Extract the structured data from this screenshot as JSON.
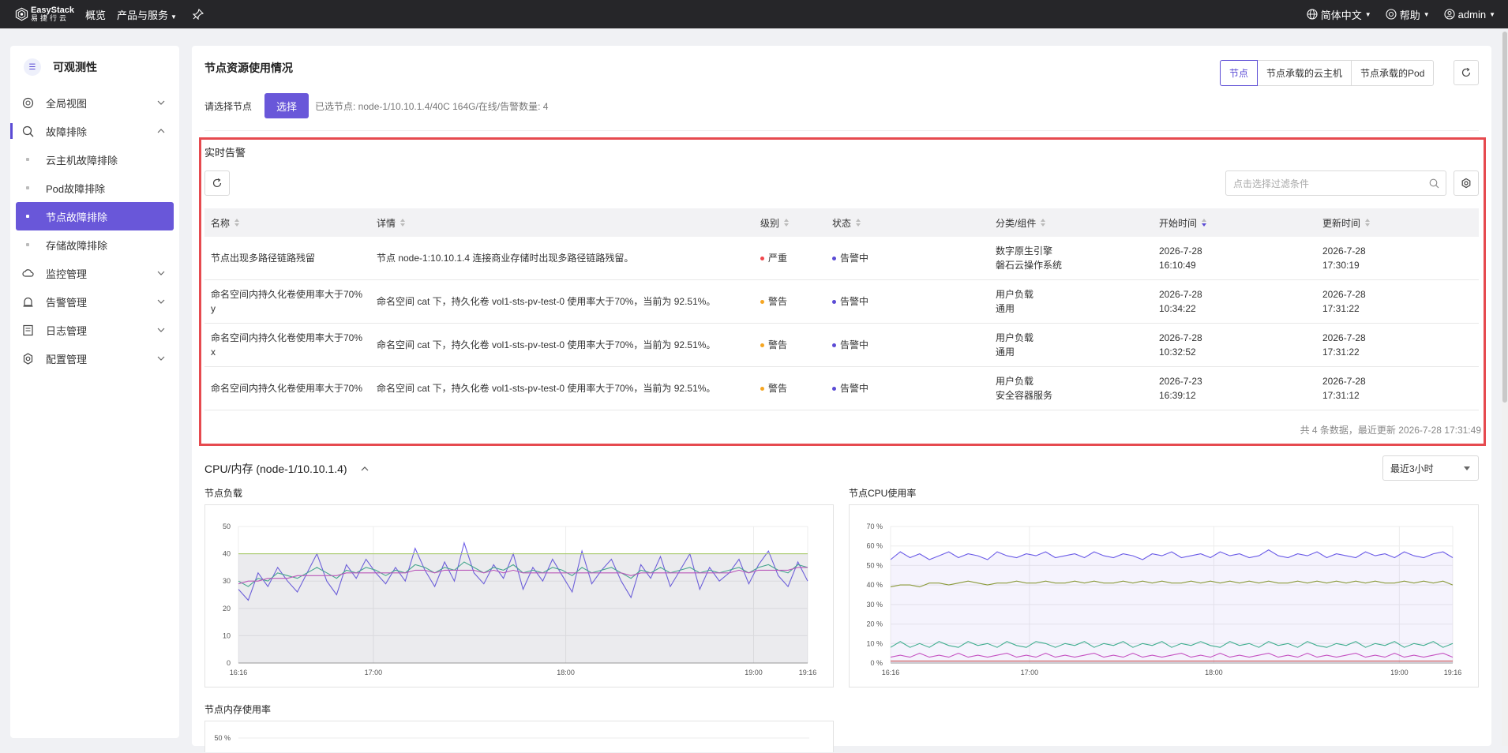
{
  "topbar": {
    "logo_line1": "EasyStack",
    "logo_line2": "易捷行云",
    "nav": [
      {
        "label": "概览"
      },
      {
        "label": "产品与服务"
      }
    ],
    "right": {
      "language": "简体中文",
      "help": "帮助",
      "user": "admin"
    }
  },
  "sidebar": {
    "title": "可观测性",
    "items": [
      {
        "label": "全局视图",
        "icon": "globe-icon"
      },
      {
        "label": "故障排除",
        "icon": "search-icon",
        "open": true,
        "children": [
          {
            "label": "云主机故障排除"
          },
          {
            "label": "Pod故障排除"
          },
          {
            "label": "节点故障排除",
            "active": true
          },
          {
            "label": "存储故障排除"
          }
        ]
      },
      {
        "label": "监控管理",
        "icon": "cloud-icon"
      },
      {
        "label": "告警管理",
        "icon": "alarm-icon"
      },
      {
        "label": "日志管理",
        "icon": "log-icon"
      },
      {
        "label": "配置管理",
        "icon": "gear-icon"
      }
    ]
  },
  "main": {
    "title": "节点资源使用情况",
    "tabs": [
      "节点",
      "节点承载的云主机",
      "节点承载的Pod"
    ],
    "select_label": "请选择节点",
    "select_button": "选择",
    "selected_info": "已选节点:  node-1/10.10.1.4/40C 164G/在线/告警数量: 4"
  },
  "alerts": {
    "title": "实时告警",
    "search_placeholder": "点击选择过滤条件",
    "columns": [
      "名称",
      "详情",
      "级别",
      "状态",
      "分类/组件",
      "开始时间",
      "更新时间"
    ],
    "rows": [
      {
        "name": "节点出现多路径链路残留",
        "detail": "节点 node-1:10.10.1.4 连接商业存储时出现多路径链路残留。",
        "level": "严重",
        "level_color": "#f0474d",
        "status": "告警中",
        "cat1": "数字原生引擎",
        "cat2": "磐石云操作系统",
        "start1": "2026-7-28",
        "start2": "16:10:49",
        "upd1": "2026-7-28",
        "upd2": "17:30:19"
      },
      {
        "name": "命名空间内持久化卷使用率大于70%",
        "name2": "y",
        "detail": "命名空间 cat 下，持久化卷 vol1-sts-pv-test-0 使用率大于70%，当前为 92.51%。",
        "level": "警告",
        "level_color": "#f5a623",
        "status": "告警中",
        "cat1": "用户负载",
        "cat2": "通用",
        "start1": "2026-7-28",
        "start2": "10:34:22",
        "upd1": "2026-7-28",
        "upd2": "17:31:22"
      },
      {
        "name": "命名空间内持久化卷使用率大于70%",
        "name2": "x",
        "detail": "命名空间 cat 下，持久化卷 vol1-sts-pv-test-0 使用率大于70%，当前为 92.51%。",
        "level": "警告",
        "level_color": "#f5a623",
        "status": "告警中",
        "cat1": "用户负载",
        "cat2": "通用",
        "start1": "2026-7-28",
        "start2": "10:32:52",
        "upd1": "2026-7-28",
        "upd2": "17:31:22"
      },
      {
        "name": "命名空间内持久化卷使用率大于70%",
        "name2": "",
        "detail": "命名空间 cat 下，持久化卷 vol1-sts-pv-test-0 使用率大于70%，当前为 92.51%。",
        "level": "警告",
        "level_color": "#f5a623",
        "status": "告警中",
        "cat1": "用户负载",
        "cat2": "安全容器服务",
        "start1": "2026-7-23",
        "start2": "16:39:12",
        "upd1": "2026-7-28",
        "upd2": "17:31:12"
      }
    ],
    "footer": "共 4 条数据，最近更新  2026-7-28 17:31:49"
  },
  "cpu": {
    "title": "CPU/内存 (node-1/10.10.1.4)",
    "range": "最近3小时"
  },
  "chart_data": [
    {
      "type": "line",
      "title": "节点负载",
      "x_ticks": [
        "16:16",
        "17:00",
        "18:00",
        "19:00",
        "19:16"
      ],
      "y_ticks": [
        "0",
        "10",
        "20",
        "30",
        "40",
        "50"
      ],
      "ylim": [
        0,
        50
      ],
      "series": [
        {
          "values": [
            27,
            23,
            33,
            28,
            35,
            30,
            26,
            33,
            40,
            30,
            25,
            36,
            31,
            38,
            33,
            29,
            35,
            30,
            42,
            34,
            28,
            37,
            30,
            44,
            33,
            29,
            36,
            31,
            40,
            27,
            35,
            30,
            38,
            32,
            26,
            41,
            29,
            34,
            38,
            30,
            24,
            36,
            31,
            39,
            28,
            34,
            40,
            27,
            35,
            30,
            33,
            38,
            29,
            36,
            41,
            32,
            28,
            37,
            30
          ]
        },
        {
          "values": [
            30,
            28,
            31,
            30,
            33,
            32,
            31,
            33,
            35,
            33,
            31,
            34,
            33,
            35,
            34,
            32,
            34,
            33,
            36,
            35,
            33,
            35,
            34,
            37,
            35,
            33,
            35,
            34,
            36,
            33,
            34,
            33,
            35,
            34,
            32,
            35,
            33,
            34,
            35,
            33,
            31,
            34,
            33,
            35,
            33,
            34,
            35,
            33,
            34,
            33,
            34,
            35,
            33,
            35,
            36,
            34,
            33,
            36,
            35
          ]
        },
        {
          "values": [
            29,
            30,
            30,
            31,
            31,
            31,
            32,
            32,
            32,
            32,
            32,
            33,
            33,
            33,
            33,
            33,
            33,
            33,
            34,
            34,
            33,
            34,
            34,
            34,
            34,
            33,
            34,
            33,
            34,
            33,
            33,
            33,
            33,
            33,
            33,
            33,
            33,
            33,
            33,
            33,
            32,
            33,
            33,
            33,
            33,
            33,
            33,
            33,
            33,
            33,
            33,
            34,
            33,
            34,
            34,
            34,
            34,
            35,
            35
          ]
        },
        {
          "values": [
            40,
            40,
            40,
            40,
            40,
            40,
            40,
            40,
            40,
            40,
            40,
            40,
            40,
            40,
            40,
            40,
            40,
            40,
            40,
            40,
            40,
            40,
            40,
            40,
            40,
            40,
            40,
            40,
            40,
            40,
            40,
            40,
            40,
            40,
            40,
            40,
            40,
            40,
            40,
            40,
            40,
            40,
            40,
            40,
            40,
            40,
            40,
            40,
            40,
            40,
            40,
            40,
            40,
            40,
            40,
            40,
            40,
            40,
            40
          ]
        }
      ]
    },
    {
      "type": "line",
      "title": "节点CPU使用率",
      "x_ticks": [
        "16:16",
        "17:00",
        "18:00",
        "19:00",
        "19:16"
      ],
      "y_ticks": [
        "0 %",
        "10 %",
        "20 %",
        "30 %",
        "40 %",
        "50 %",
        "60 %",
        "70 %"
      ],
      "ylim": [
        0,
        70
      ],
      "series": [
        {
          "values": [
            53,
            57,
            54,
            56,
            53,
            55,
            57,
            54,
            56,
            55,
            53,
            57,
            55,
            54,
            56,
            55,
            57,
            54,
            55,
            56,
            54,
            57,
            55,
            54,
            56,
            55,
            53,
            56,
            55,
            57,
            54,
            55,
            56,
            54,
            57,
            55,
            56,
            54,
            55,
            58,
            55,
            54,
            56,
            55,
            57,
            54,
            56,
            55,
            54,
            57,
            55,
            56,
            54,
            57,
            55,
            54,
            56,
            57,
            54
          ]
        },
        {
          "values": [
            39,
            40,
            40,
            39,
            41,
            41,
            40,
            41,
            42,
            41,
            40,
            41,
            41,
            42,
            41,
            41,
            42,
            41,
            41,
            42,
            41,
            42,
            41,
            41,
            42,
            41,
            42,
            41,
            42,
            41,
            41,
            42,
            41,
            42,
            41,
            42,
            41,
            42,
            41,
            42,
            41,
            41,
            42,
            41,
            42,
            41,
            42,
            41,
            42,
            41,
            42,
            41,
            41,
            42,
            41,
            42,
            41,
            42,
            40
          ]
        },
        {
          "values": [
            8,
            11,
            8,
            10,
            8,
            11,
            9,
            8,
            11,
            9,
            10,
            8,
            11,
            9,
            8,
            11,
            10,
            8,
            10,
            9,
            11,
            8,
            10,
            9,
            11,
            8,
            10,
            9,
            11,
            8,
            10,
            9,
            11,
            9,
            8,
            11,
            9,
            10,
            8,
            11,
            9,
            10,
            8,
            11,
            9,
            8,
            10,
            9,
            11,
            8,
            10,
            9,
            11,
            8,
            10,
            9,
            11,
            8,
            10
          ]
        },
        {
          "values": [
            3,
            4,
            3,
            5,
            3,
            4,
            3,
            5,
            3,
            4,
            3,
            4,
            5,
            3,
            4,
            3,
            5,
            3,
            4,
            3,
            4,
            5,
            3,
            4,
            3,
            5,
            3,
            4,
            3,
            4,
            5,
            3,
            4,
            3,
            5,
            3,
            4,
            3,
            4,
            5,
            3,
            4,
            3,
            5,
            3,
            4,
            3,
            4,
            5,
            3,
            4,
            3,
            5,
            3,
            4,
            3,
            4,
            5,
            3
          ]
        },
        {
          "values": [
            1,
            1,
            1,
            1,
            1,
            1,
            1,
            1,
            1,
            1,
            1,
            1,
            1,
            1,
            1,
            1,
            1,
            1,
            1,
            1,
            1,
            1,
            1,
            1,
            1,
            1,
            1,
            1,
            1,
            1,
            1,
            1,
            1,
            1,
            1,
            1,
            1,
            1,
            1,
            1,
            1,
            1,
            1,
            1,
            1,
            1,
            1,
            1,
            1,
            1,
            1,
            1,
            1,
            1,
            1,
            1,
            1,
            1,
            1
          ]
        }
      ]
    },
    {
      "type": "line",
      "title": "节点内存使用率",
      "y_ticks": [
        "50 %"
      ]
    }
  ]
}
